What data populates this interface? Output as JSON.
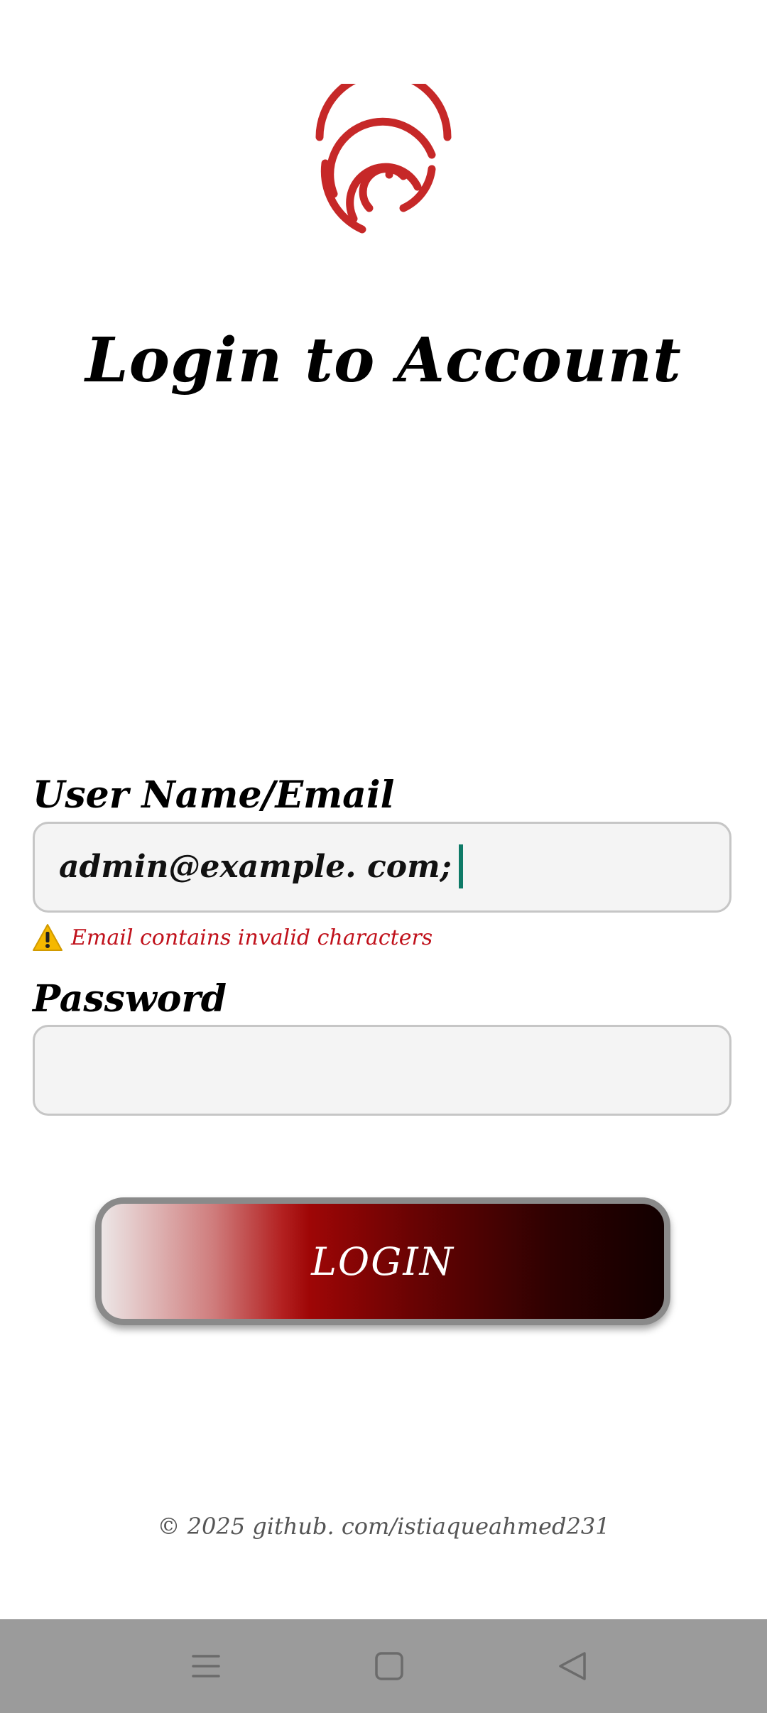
{
  "header": {
    "logo_icon": "fingerprint-icon",
    "title": "Login to Account"
  },
  "form": {
    "email_label": "User Name/Email",
    "email_value": "admin@example. com;",
    "email_error": "Email contains invalid characters",
    "error_icon": "warning-icon",
    "password_label": "Password",
    "password_value": "",
    "login_label": "LOGIN"
  },
  "footer": {
    "text": "© 2025 github. com/istiaqueahmed231"
  },
  "navbar": {
    "menu_icon": "menu-icon",
    "home_icon": "home-square-icon",
    "back_icon": "back-triangle-icon"
  },
  "colors": {
    "accent": "#c62828",
    "error": "#c0111b",
    "caret": "#0e7a67",
    "navbar": "#9b9b9b"
  }
}
